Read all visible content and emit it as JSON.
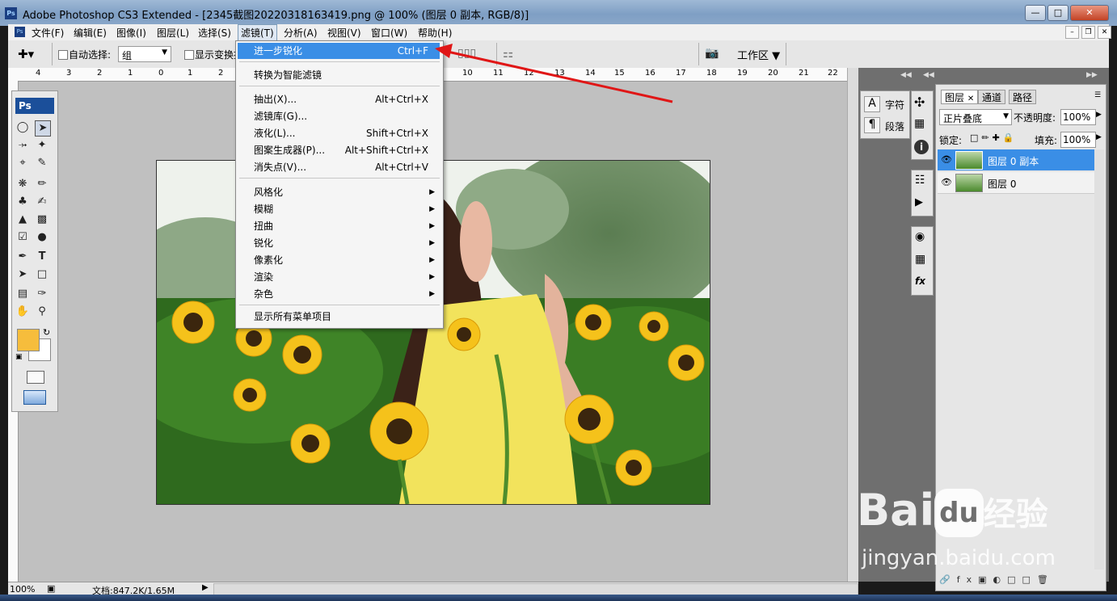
{
  "window": {
    "title": "Adobe Photoshop CS3 Extended - [2345截图20220318163419.png @ 100% (图层 0 副本, RGB/8)]",
    "app_icon": "Ps"
  },
  "menubar": {
    "items": [
      "文件(F)",
      "编辑(E)",
      "图像(I)",
      "图层(L)",
      "选择(S)",
      "滤镜(T)",
      "分析(A)",
      "视图(V)",
      "窗口(W)",
      "帮助(H)"
    ]
  },
  "options": {
    "auto_select_label": "自动选择:",
    "auto_select_value": "组",
    "show_transform_label": "显示变换控件",
    "workspace_label": "工作区"
  },
  "ruler": {
    "h": [
      "4",
      "3",
      "2",
      "1",
      "0",
      "1",
      "2",
      "10",
      "11",
      "12",
      "13",
      "14",
      "15",
      "16",
      "17",
      "18",
      "19",
      "20",
      "21",
      "22"
    ]
  },
  "filter_menu": {
    "items": [
      {
        "label": "进一步锐化",
        "shortcut": "Ctrl+F",
        "highlighted": true
      },
      {
        "label": "转换为智能滤镜",
        "shortcut": ""
      },
      {
        "label": "抽出(X)...",
        "shortcut": "Alt+Ctrl+X"
      },
      {
        "label": "滤镜库(G)...",
        "shortcut": ""
      },
      {
        "label": "液化(L)...",
        "shortcut": "Shift+Ctrl+X"
      },
      {
        "label": "图案生成器(P)...",
        "shortcut": "Alt+Shift+Ctrl+X"
      },
      {
        "label": "消失点(V)...",
        "shortcut": "Alt+Ctrl+V"
      },
      {
        "label": "风格化",
        "submenu": true
      },
      {
        "label": "模糊",
        "submenu": true
      },
      {
        "label": "扭曲",
        "submenu": true
      },
      {
        "label": "锐化",
        "submenu": true
      },
      {
        "label": "像素化",
        "submenu": true
      },
      {
        "label": "渲染",
        "submenu": true
      },
      {
        "label": "杂色",
        "submenu": true
      },
      {
        "label": "显示所有菜单项目",
        "shortcut": ""
      }
    ]
  },
  "toolbox": {
    "title": "Ps",
    "foreground_color": "#f6bd3c",
    "background_color": "#ffffff"
  },
  "char_panel": {
    "char_label": "字符",
    "para_label": "段落"
  },
  "layers_panel": {
    "tabs": [
      "图层",
      "通道",
      "路径"
    ],
    "blend_mode": "正片叠底",
    "opacity_label": "不透明度:",
    "opacity_value": "100%",
    "lock_label": "锁定:",
    "fill_label": "填充:",
    "fill_value": "100%",
    "layers": [
      {
        "name": "图层 0 副本",
        "selected": true
      },
      {
        "name": "图层 0",
        "selected": false
      }
    ]
  },
  "status": {
    "zoom": "100%",
    "doc_info": "文档:847.2K/1.65M"
  },
  "watermark": {
    "brand": "Bai",
    "du": "du",
    "cn": "经验",
    "url": "jingyan.baidu.com"
  },
  "colors": {
    "accent": "#3a8ee6",
    "arrow": "#e01616",
    "titlebar": "#8aa7c9"
  }
}
